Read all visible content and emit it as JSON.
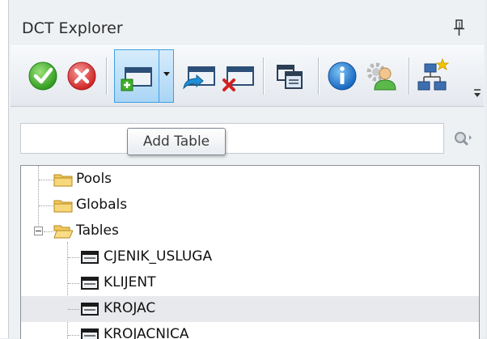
{
  "panel": {
    "title": "DCT Explorer"
  },
  "toolbar": {
    "buttons": [
      {
        "name": "confirm-icon"
      },
      {
        "name": "cancel-icon"
      },
      {
        "name": "add-table-icon"
      },
      {
        "name": "edit-table-icon"
      },
      {
        "name": "delete-table-icon"
      },
      {
        "name": "copy-icon"
      },
      {
        "name": "info-icon"
      },
      {
        "name": "user-settings-icon"
      },
      {
        "name": "hierarchy-icon"
      }
    ]
  },
  "search": {
    "value": "",
    "placeholder": ""
  },
  "tooltip": {
    "text": "Add Table"
  },
  "tree": {
    "items": [
      {
        "label": "Pools",
        "type": "folder"
      },
      {
        "label": "Globals",
        "type": "folder"
      },
      {
        "label": "Tables",
        "type": "folder-open"
      },
      {
        "label": "CJENIK_USLUGA",
        "type": "table"
      },
      {
        "label": "KLIJENT",
        "type": "table"
      },
      {
        "label": "KROJAC",
        "type": "table",
        "selected": true
      },
      {
        "label": "KROJACNICA",
        "type": "table"
      }
    ]
  }
}
